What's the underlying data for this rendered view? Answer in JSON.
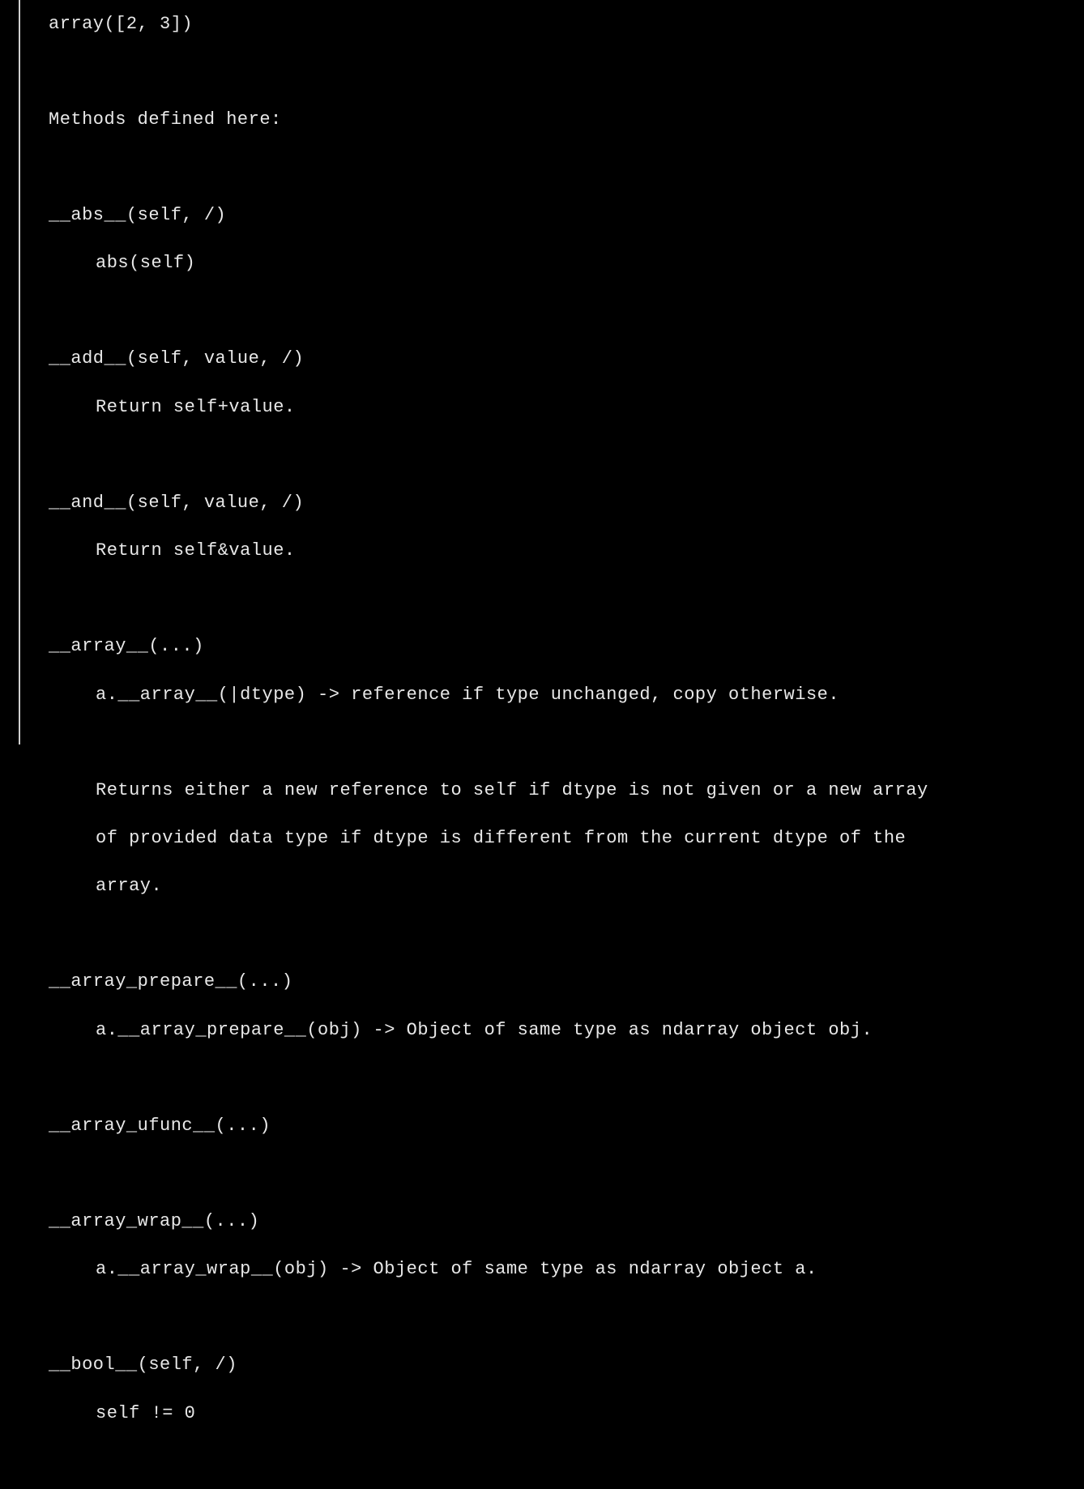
{
  "terminal": {
    "lines": {
      "l0": "array([2, 3])",
      "l1": "",
      "l2": "Methods defined here:",
      "l3": "",
      "l4": "__abs__(self, /)",
      "l5": "abs(self)",
      "l6": "",
      "l7": "__add__(self, value, /)",
      "l8": "Return self+value.",
      "l9": "",
      "l10": "__and__(self, value, /)",
      "l11": "Return self&value.",
      "l12": "",
      "l13": "__array__(...)",
      "l14": "a.__array__(|dtype) -> reference if type unchanged, copy otherwise.",
      "l15": "",
      "l16": "Returns either a new reference to self if dtype is not given or a new array",
      "l17": "of provided data type if dtype is different from the current dtype of the",
      "l18": "array.",
      "l19": "",
      "l20": "__array_prepare__(...)",
      "l21": "a.__array_prepare__(obj) -> Object of same type as ndarray object obj.",
      "l22": "",
      "l23": "__array_ufunc__(...)",
      "l24": "",
      "l25": "__array_wrap__(...)",
      "l26": "a.__array_wrap__(obj) -> Object of same type as ndarray object a.",
      "l27": "",
      "l28": "__bool__(self, /)",
      "l29": "self != 0",
      "l30": ""
    }
  }
}
